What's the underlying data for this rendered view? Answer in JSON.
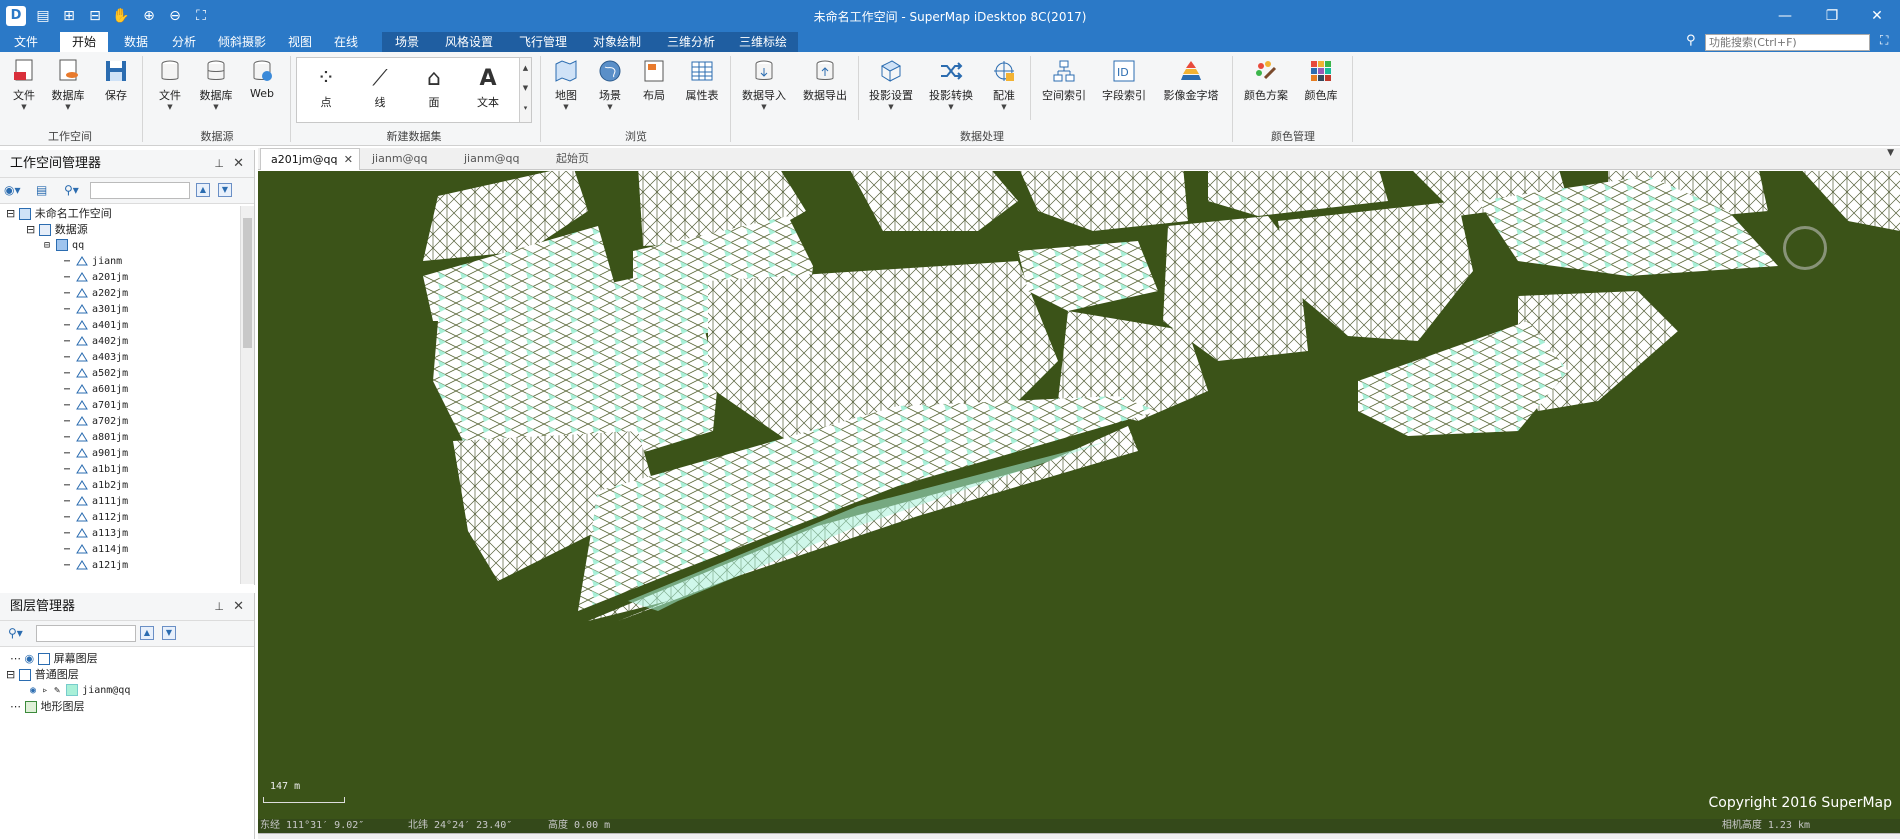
{
  "window": {
    "title": "未命名工作空间 - SuperMap iDesktop 8C(2017)",
    "app_icon": "supermap-logo-icon"
  },
  "quick_access": [
    "save-icon",
    "import-icon",
    "export-icon",
    "hand-pan-icon",
    "zoom-in-icon",
    "zoom-out-icon",
    "full-extent-icon"
  ],
  "menu_tabs": [
    {
      "label": "文件"
    },
    {
      "label": "开始",
      "active": true
    },
    {
      "label": "数据"
    },
    {
      "label": "分析"
    },
    {
      "label": "倾斜摄影"
    },
    {
      "label": "视图"
    },
    {
      "label": "在线"
    },
    {
      "label": "场景",
      "scene": true
    },
    {
      "label": "风格设置",
      "scene": true
    },
    {
      "label": "飞行管理",
      "scene": true
    },
    {
      "label": "对象绘制",
      "scene": true
    },
    {
      "label": "三维分析",
      "scene": true
    },
    {
      "label": "三维标绘",
      "scene": true
    }
  ],
  "search": {
    "placeholder": "功能搜索(Ctrl+F)"
  },
  "ribbon": {
    "workspace": {
      "label": "工作空间",
      "buttons": [
        "文件",
        "数据库",
        "保存"
      ]
    },
    "datasource": {
      "label": "数据源",
      "buttons": [
        "文件",
        "数据库",
        "Web"
      ]
    },
    "new_dataset": {
      "label": "新建数据集",
      "items": [
        "点",
        "线",
        "面",
        "文本"
      ]
    },
    "browse": {
      "label": "浏览",
      "buttons": [
        "地图",
        "场景",
        "布局",
        "属性表"
      ]
    },
    "data_processing": {
      "label": "数据处理",
      "buttons": [
        "数据导入",
        "数据导出",
        "投影设置",
        "投影转换",
        "配准",
        "空间索引",
        "字段索引",
        "影像金字塔"
      ]
    },
    "color": {
      "label": "颜色管理",
      "buttons": [
        "颜色方案",
        "颜色库"
      ]
    }
  },
  "workspace_manager": {
    "title": "工作空间管理器",
    "root": "未命名工作空间",
    "datasources_label": "数据源",
    "datasource": "qq",
    "datasets": [
      "jianm",
      "a201jm",
      "a202jm",
      "a301jm",
      "a401jm",
      "a402jm",
      "a403jm",
      "a502jm",
      "a601jm",
      "a701jm",
      "a702jm",
      "a801jm",
      "a901jm",
      "a1b1jm",
      "a1b2jm",
      "a111jm",
      "a112jm",
      "a113jm",
      "a114jm",
      "a121jm"
    ]
  },
  "layer_manager": {
    "title": "图层管理器",
    "screen_layers": "屏幕图层",
    "normal_layers": "普通图层",
    "layer": "jianm@qq",
    "terrain_layers": "地形图层"
  },
  "doc_tabs": [
    {
      "label": "a201jm@qq",
      "active": true
    },
    {
      "label": "jianm@qq"
    },
    {
      "label": "jianm@qq"
    },
    {
      "label": "起始页"
    }
  ],
  "map": {
    "scale": "147 m",
    "copyright": "Copyright 2016 SuperMap",
    "background_color": "#3b5318",
    "fill_color": "#a8f0d8"
  },
  "status": {
    "longitude": "东经 111°31′ 9.02″",
    "latitude": "北纬 24°24′ 23.40″",
    "altitude": "高度 0.00 m",
    "camera_height": "相机高度 1.23 km"
  }
}
